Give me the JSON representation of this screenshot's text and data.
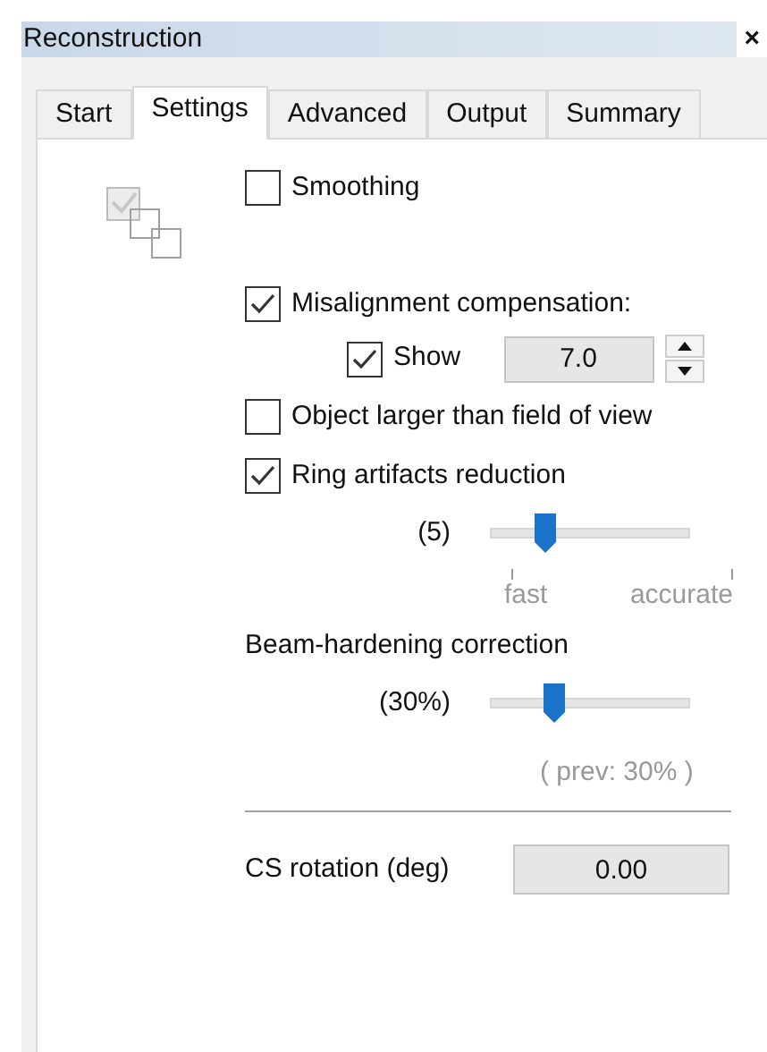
{
  "window": {
    "title": "Reconstruction",
    "close": "×"
  },
  "tabs": [
    {
      "label": "Start",
      "selected": false
    },
    {
      "label": "Settings",
      "selected": true
    },
    {
      "label": "Advanced",
      "selected": false
    },
    {
      "label": "Output",
      "selected": false
    },
    {
      "label": "Summary",
      "selected": false
    }
  ],
  "smoothing": {
    "label": "Smoothing",
    "checked": false
  },
  "misalignment": {
    "label": "Misalignment compensation:",
    "checked": true,
    "show": {
      "label": "Show",
      "checked": true
    },
    "value": "7.0"
  },
  "object_larger": {
    "label": "Object larger than field of view",
    "checked": false
  },
  "ring_artifacts": {
    "label": "Ring artifacts reduction",
    "checked": true,
    "reading": "(5)",
    "level": 0.27,
    "min_label": "fast",
    "max_label": "accurate"
  },
  "beam_hardening": {
    "label": "Beam-hardening correction",
    "reading": "(30%)",
    "level": 0.32,
    "previous": "( prev: 30% )"
  },
  "cs_rotation": {
    "label": "CS rotation (deg)",
    "value": "0.00"
  }
}
